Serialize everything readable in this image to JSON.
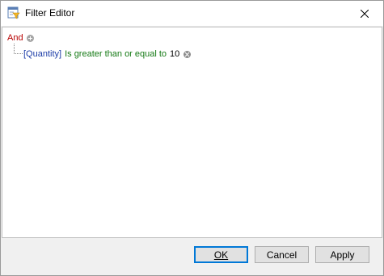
{
  "window": {
    "title": "Filter Editor",
    "icon": "filter-editor-icon"
  },
  "filter": {
    "group_operator": "And",
    "conditions": [
      {
        "field": "[Quantity]",
        "operator": "Is greater than or equal to",
        "value": "10"
      }
    ]
  },
  "buttons": {
    "ok": "OK",
    "cancel": "Cancel",
    "apply": "Apply"
  },
  "colors": {
    "group_operator": "#b70000",
    "field": "#1c3ca7",
    "operator": "#157a15",
    "default_button_border": "#0078d7"
  }
}
